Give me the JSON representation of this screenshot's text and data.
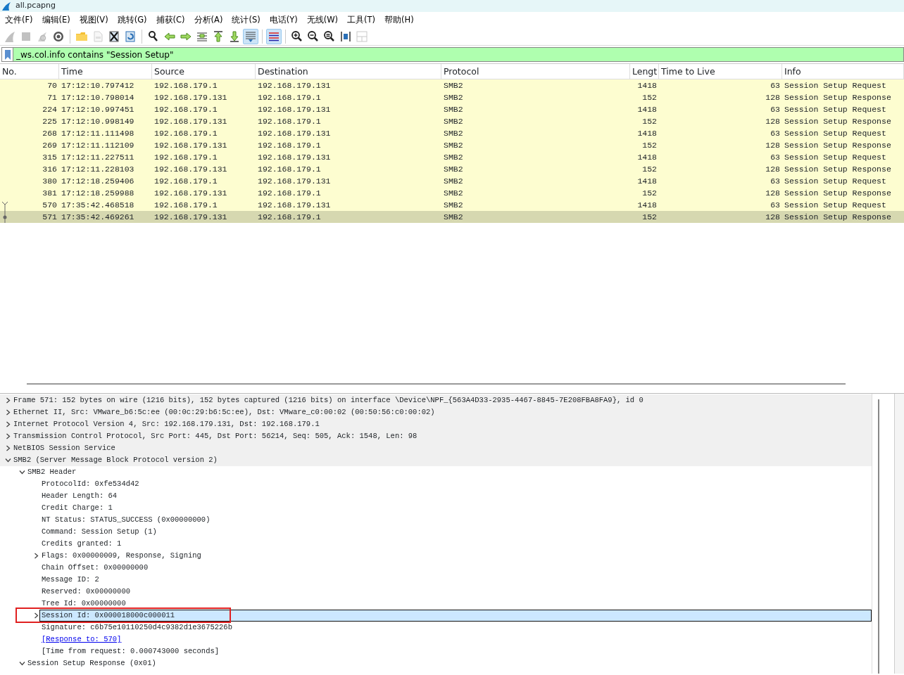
{
  "window": {
    "title": "all.pcapng"
  },
  "menu": [
    {
      "label": "文件(F)"
    },
    {
      "label": "编辑(E)"
    },
    {
      "label": "视图(V)"
    },
    {
      "label": "跳转(G)"
    },
    {
      "label": "捕获(C)"
    },
    {
      "label": "分析(A)"
    },
    {
      "label": "统计(S)"
    },
    {
      "label": "电话(Y)"
    },
    {
      "label": "无线(W)"
    },
    {
      "label": "工具(T)"
    },
    {
      "label": "帮助(H)"
    }
  ],
  "toolbar": [
    {
      "kind": "start",
      "disabled": true,
      "pressed": false
    },
    {
      "kind": "stop",
      "disabled": true,
      "pressed": false
    },
    {
      "kind": "restart",
      "disabled": true,
      "pressed": false
    },
    {
      "kind": "options",
      "disabled": false,
      "pressed": false
    },
    {
      "kind": "separator"
    },
    {
      "kind": "open",
      "disabled": false,
      "pressed": false
    },
    {
      "kind": "save",
      "disabled": true,
      "pressed": false
    },
    {
      "kind": "close",
      "disabled": false,
      "pressed": false
    },
    {
      "kind": "reload",
      "disabled": false,
      "pressed": false
    },
    {
      "kind": "separator"
    },
    {
      "kind": "find",
      "disabled": false,
      "pressed": false
    },
    {
      "kind": "back",
      "disabled": false,
      "pressed": false
    },
    {
      "kind": "forward",
      "disabled": false,
      "pressed": false
    },
    {
      "kind": "goto",
      "disabled": false,
      "pressed": false
    },
    {
      "kind": "first",
      "disabled": false,
      "pressed": false
    },
    {
      "kind": "last",
      "disabled": false,
      "pressed": false
    },
    {
      "kind": "autoscroll",
      "disabled": false,
      "pressed": true
    },
    {
      "kind": "separator"
    },
    {
      "kind": "colorize",
      "disabled": false,
      "pressed": true
    },
    {
      "kind": "separator"
    },
    {
      "kind": "zoom-in",
      "disabled": false,
      "pressed": false
    },
    {
      "kind": "zoom-out",
      "disabled": false,
      "pressed": false
    },
    {
      "kind": "zoom-reset",
      "disabled": false,
      "pressed": false
    },
    {
      "kind": "resize",
      "disabled": false,
      "pressed": false
    },
    {
      "kind": "layout",
      "disabled": true,
      "pressed": false
    }
  ],
  "filter": {
    "value": "_ws.col.info contains \"Session Setup\"",
    "valid": true
  },
  "table": {
    "columns": [
      "No.",
      "Time",
      "Source",
      "Destination",
      "Protocol",
      "Lengt",
      "Time to Live",
      "Info"
    ],
    "rows": [
      {
        "cells": [
          "70",
          "17:12:10.797412",
          "192.168.179.1",
          "192.168.179.131",
          "SMB2",
          "1418",
          "63",
          "Session Setup Request"
        ],
        "selected": false
      },
      {
        "cells": [
          "71",
          "17:12:10.798014",
          "192.168.179.131",
          "192.168.179.1",
          "SMB2",
          "152",
          "128",
          "Session Setup Response"
        ],
        "selected": false
      },
      {
        "cells": [
          "224",
          "17:12:10.997451",
          "192.168.179.1",
          "192.168.179.131",
          "SMB2",
          "1418",
          "63",
          "Session Setup Request"
        ],
        "selected": false
      },
      {
        "cells": [
          "225",
          "17:12:10.998149",
          "192.168.179.131",
          "192.168.179.1",
          "SMB2",
          "152",
          "128",
          "Session Setup Response"
        ],
        "selected": false
      },
      {
        "cells": [
          "268",
          "17:12:11.111498",
          "192.168.179.1",
          "192.168.179.131",
          "SMB2",
          "1418",
          "63",
          "Session Setup Request"
        ],
        "selected": false
      },
      {
        "cells": [
          "269",
          "17:12:11.112109",
          "192.168.179.131",
          "192.168.179.1",
          "SMB2",
          "152",
          "128",
          "Session Setup Response"
        ],
        "selected": false
      },
      {
        "cells": [
          "315",
          "17:12:11.227511",
          "192.168.179.1",
          "192.168.179.131",
          "SMB2",
          "1418",
          "63",
          "Session Setup Request"
        ],
        "selected": false
      },
      {
        "cells": [
          "316",
          "17:12:11.228103",
          "192.168.179.131",
          "192.168.179.1",
          "SMB2",
          "152",
          "128",
          "Session Setup Response"
        ],
        "selected": false
      },
      {
        "cells": [
          "380",
          "17:12:18.259406",
          "192.168.179.1",
          "192.168.179.131",
          "SMB2",
          "1418",
          "63",
          "Session Setup Request"
        ],
        "selected": false
      },
      {
        "cells": [
          "381",
          "17:12:18.259988",
          "192.168.179.131",
          "192.168.179.1",
          "SMB2",
          "152",
          "128",
          "Session Setup Response"
        ],
        "selected": false
      },
      {
        "cells": [
          "570",
          "17:35:42.468518",
          "192.168.179.1",
          "192.168.179.131",
          "SMB2",
          "1418",
          "63",
          "Session Setup Request"
        ],
        "selected": false,
        "kind": "request"
      },
      {
        "cells": [
          "571",
          "17:35:42.469261",
          "192.168.179.131",
          "192.168.179.1",
          "SMB2",
          "152",
          "128",
          "Session Setup Response"
        ],
        "selected": true,
        "kind": "response"
      }
    ]
  },
  "details": [
    {
      "text": "Frame 571: 152 bytes on wire (1216 bits), 152 bytes captured (1216 bits) on interface \\Device\\NPF_{563A4D33-2935-4467-8845-7E208FBA8FA9}, id 0",
      "expanded": false,
      "selected": false
    },
    {
      "text": "Ethernet II, Src: VMware_b6:5c:ee (00:0c:29:b6:5c:ee), Dst: VMware_c0:00:02 (00:50:56:c0:00:02)",
      "expanded": false,
      "selected": false
    },
    {
      "text": "Internet Protocol Version 4, Src: 192.168.179.131, Dst: 192.168.179.1",
      "expanded": false,
      "selected": false
    },
    {
      "text": "Transmission Control Protocol, Src Port: 445, Dst Port: 56214, Seq: 505, Ack: 1548, Len: 98",
      "expanded": false,
      "selected": false
    },
    {
      "text": "NetBIOS Session Service",
      "expanded": false,
      "selected": false
    },
    {
      "text": "SMB2 (Server Message Block Protocol version 2)",
      "expanded": true,
      "selected": false,
      "children": [
        {
          "text": "SMB2 Header",
          "expanded": true,
          "selected": false,
          "children": [
            {
              "text": "ProtocolId: 0xfe534d42",
              "selected": false
            },
            {
              "text": "Header Length: 64",
              "selected": false
            },
            {
              "text": "Credit Charge: 1",
              "selected": false
            },
            {
              "text": "NT Status: STATUS_SUCCESS (0x00000000)",
              "selected": false
            },
            {
              "text": "Command: Session Setup (1)",
              "selected": false
            },
            {
              "text": "Credits granted: 1",
              "selected": false
            },
            {
              "text": "Flags: 0x00000009, Response, Signing",
              "expanded": false,
              "selected": false
            },
            {
              "text": "Chain Offset: 0x00000000",
              "selected": false
            },
            {
              "text": "Message ID: 2",
              "selected": false
            },
            {
              "text": "Reserved: 0x00000000",
              "selected": false
            },
            {
              "text": "Tree Id: 0x00000000",
              "selected": false
            },
            {
              "text": "Session Id: 0x000018000c000011",
              "expanded": false,
              "selected": true,
              "highlighted": true
            },
            {
              "text": "Signature: c6b75e10110250d4c9382d1e3675226b",
              "selected": false
            },
            {
              "text": "[Response to: 570]",
              "selected": false,
              "kind": "link"
            },
            {
              "text": "[Time from request: 0.000743000 seconds]",
              "selected": false
            }
          ]
        },
        {
          "text": "Session Setup Response (0x01)",
          "expanded": true,
          "selected": false
        }
      ]
    }
  ]
}
